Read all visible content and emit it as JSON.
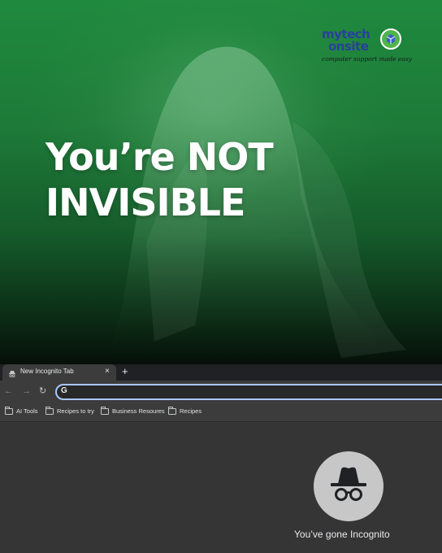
{
  "hero": {
    "headline_line1": "You’re NOT",
    "headline_line2": "INVISIBLE"
  },
  "logo": {
    "line1": "mytech",
    "line2": "onsite",
    "tagline": "computer support made easy"
  },
  "browser": {
    "tab": {
      "title": "New Incognito Tab",
      "close_label": "×"
    },
    "new_tab_label": "+",
    "nav": {
      "back": "←",
      "forward": "→",
      "reload": "↻"
    },
    "omnibox": {
      "icon": "G",
      "value": ""
    },
    "bookmarks": [
      {
        "label": "AI Tools"
      },
      {
        "label": "Recipes to try"
      },
      {
        "label": "Business Resoures"
      },
      {
        "label": "Recipes"
      }
    ],
    "incognito_message": "You’ve gone Incognito"
  },
  "colors": {
    "hero_green": "#1f8a3e",
    "logo_blue": "#2a3f9e",
    "chrome_dark": "#3c3c3c",
    "omnibox_focus": "#a8c7fa"
  },
  "icons": [
    "incognito-tab-icon",
    "close-icon",
    "plus-icon",
    "back-arrow-icon",
    "forward-arrow-icon",
    "reload-icon",
    "google-icon",
    "folder-icon",
    "incognito-spy-icon"
  ]
}
